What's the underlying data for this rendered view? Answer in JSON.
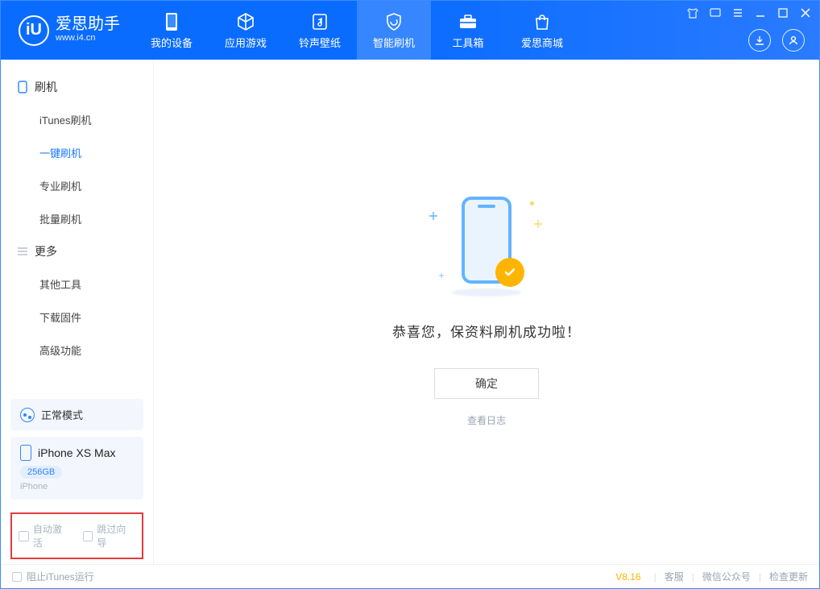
{
  "app": {
    "name": "爱思助手",
    "url": "www.i4.cn"
  },
  "nav": {
    "tabs": [
      {
        "label": "我的设备"
      },
      {
        "label": "应用游戏"
      },
      {
        "label": "铃声壁纸"
      },
      {
        "label": "智能刷机"
      },
      {
        "label": "工具箱"
      },
      {
        "label": "爱思商城"
      }
    ],
    "active_index": 3
  },
  "sidebar": {
    "group1": {
      "title": "刷机",
      "items": [
        {
          "label": "iTunes刷机"
        },
        {
          "label": "一键刷机"
        },
        {
          "label": "专业刷机"
        },
        {
          "label": "批量刷机"
        }
      ],
      "active_index": 1
    },
    "group2": {
      "title": "更多",
      "items": [
        {
          "label": "其他工具"
        },
        {
          "label": "下载固件"
        },
        {
          "label": "高级功能"
        }
      ]
    }
  },
  "status_card": {
    "label": "正常模式"
  },
  "device_card": {
    "name": "iPhone XS Max",
    "storage": "256GB",
    "type": "iPhone"
  },
  "highlight": {
    "opt1": "自动激活",
    "opt2": "跳过向导"
  },
  "main": {
    "success_text": "恭喜您，保资料刷机成功啦！",
    "ok_label": "确定",
    "log_link": "查看日志"
  },
  "footer": {
    "block_itunes": "阻止iTunes运行",
    "version": "V8.16",
    "links": [
      "客服",
      "微信公众号",
      "检查更新"
    ]
  }
}
